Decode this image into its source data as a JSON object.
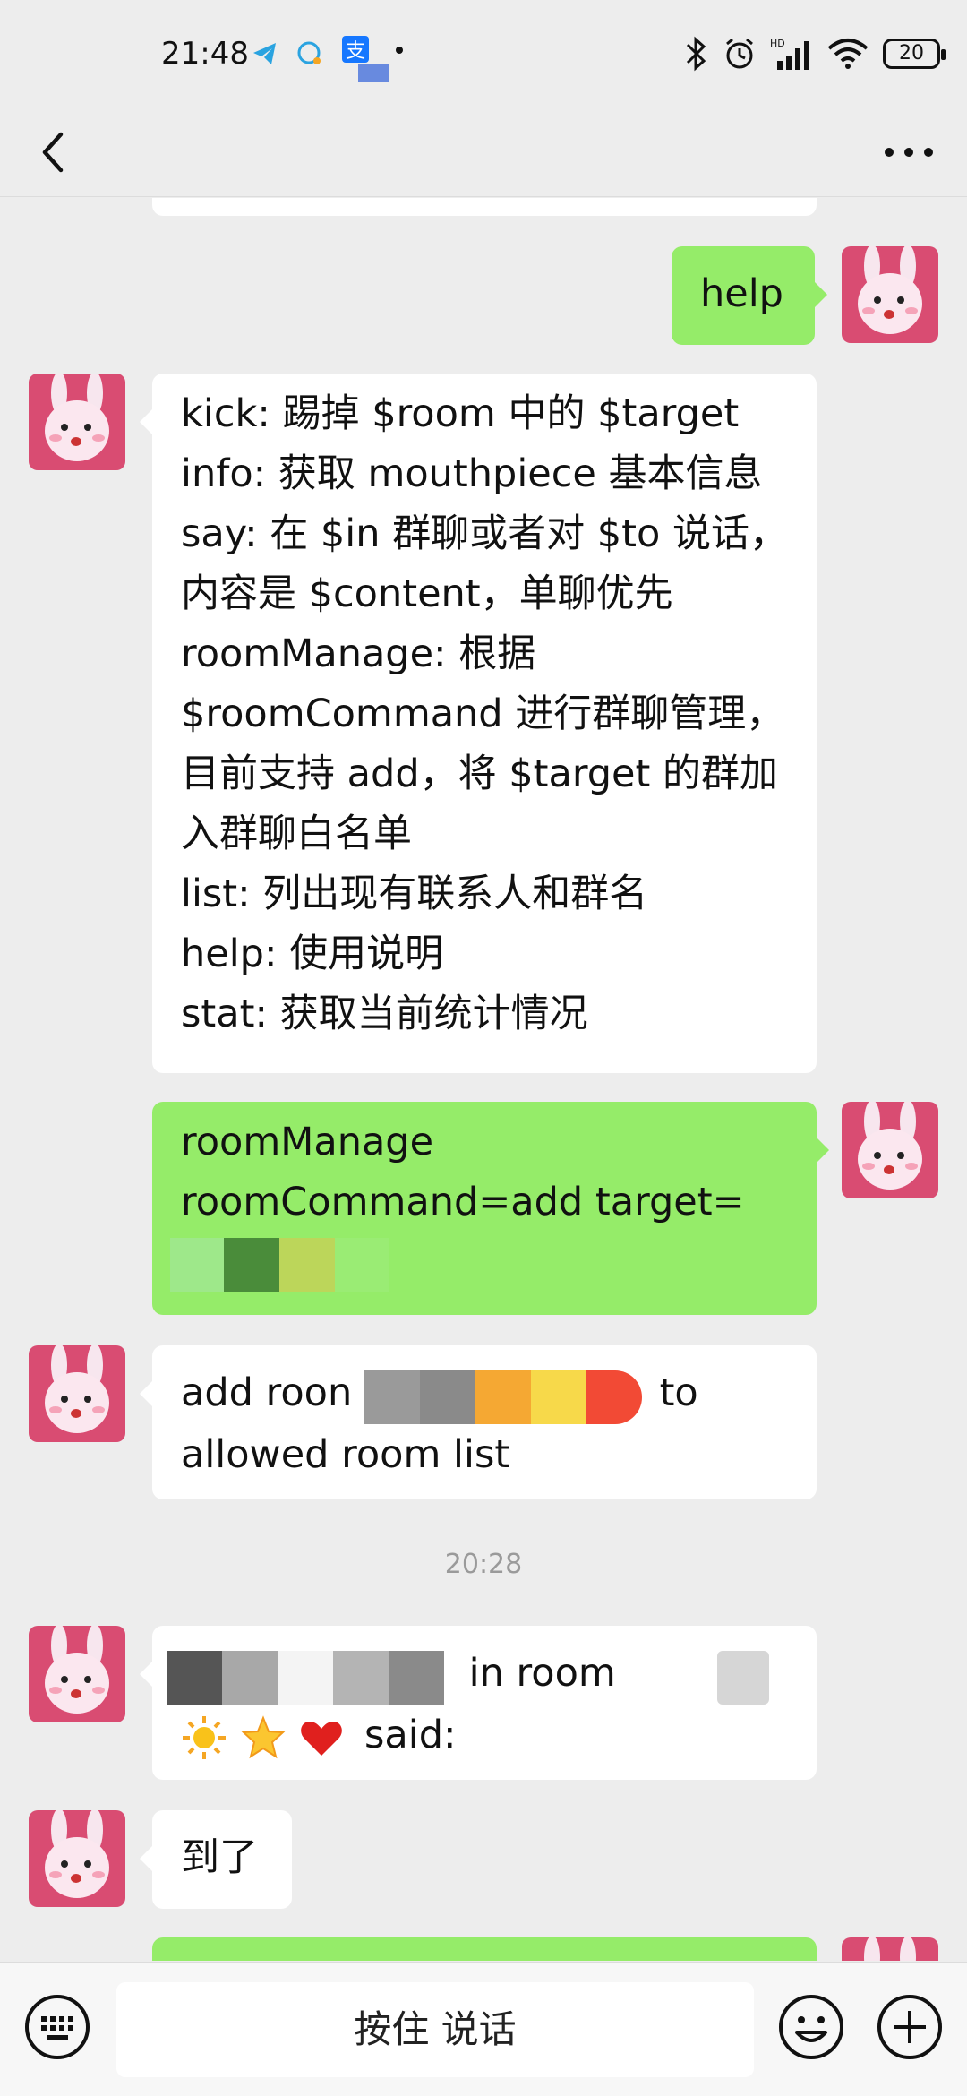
{
  "status": {
    "time": "21:48",
    "battery": "20"
  },
  "title_bar": {
    "back_icon": "chevron-left-icon",
    "more_icon": "more-dots-icon"
  },
  "messages": [
    {
      "side": "out",
      "lines": [
        "help"
      ]
    },
    {
      "side": "in",
      "lines": [
        "kick: 踢掉 $room 中的 $target",
        "info: 获取 mouthpiece 基本信息",
        "say: 在 $in 群聊或者对 $to 说话，",
        "内容是 $content，单聊优先",
        "roomManage: 根据",
        "$roomCommand 进行群聊管理，",
        "目前支持 add，将 $target 的群加",
        "入群聊白名单",
        "list: 列出现有联系人和群名",
        "help: 使用说明",
        "stat: 获取当前统计情况"
      ]
    },
    {
      "side": "out",
      "lines": [
        "roomManage",
        "roomCommand=add target="
      ]
    },
    {
      "side": "in",
      "line1_start": "add roon",
      "line1_end": "to",
      "line2": "allowed room list"
    },
    {
      "side": "in",
      "part_a": "in room",
      "part_b": "said:"
    },
    {
      "side": "in",
      "lines": [
        "到了"
      ]
    }
  ],
  "timestamp": "20:28",
  "input_bar": {
    "hold_to_talk": "按住 说话"
  },
  "colors": {
    "out_bubble": "#95ec69",
    "in_bubble": "#ffffff",
    "background": "#ededed"
  }
}
